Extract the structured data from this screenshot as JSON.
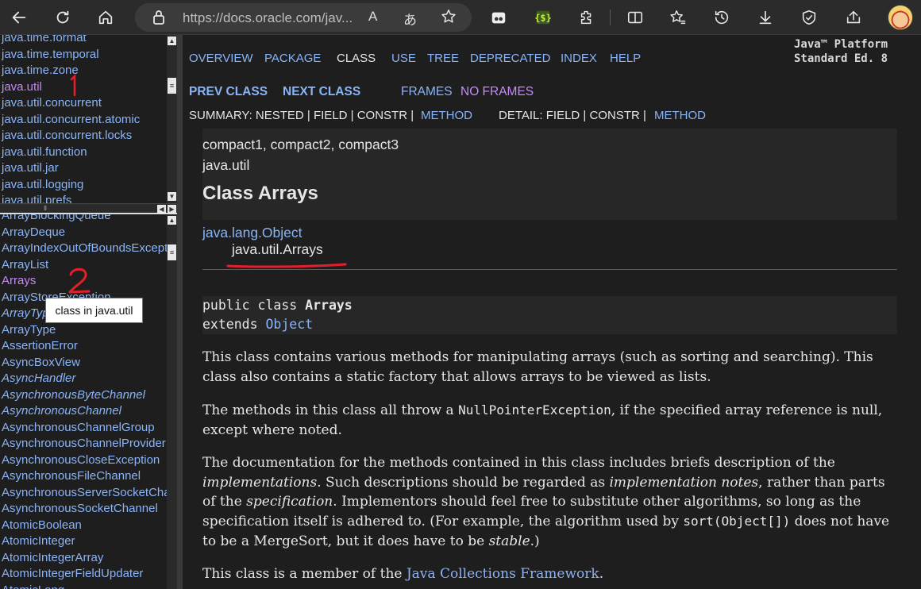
{
  "browser": {
    "url": "https://docs.oracle.com/jav...",
    "read_aloud": "A",
    "translate": "あ"
  },
  "packages_frame": {
    "items": [
      {
        "label": "java.time.format",
        "visited": false
      },
      {
        "label": "java.time.temporal",
        "visited": false
      },
      {
        "label": "java.time.zone",
        "visited": false
      },
      {
        "label": "java.util",
        "visited": true
      },
      {
        "label": "java.util.concurrent",
        "visited": false
      },
      {
        "label": "java.util.concurrent.atomic",
        "visited": false
      },
      {
        "label": "java.util.concurrent.locks",
        "visited": false
      },
      {
        "label": "java.util.function",
        "visited": false
      },
      {
        "label": "java.util.jar",
        "visited": false
      },
      {
        "label": "java.util.logging",
        "visited": false
      },
      {
        "label": "java.util.prefs",
        "visited": false
      }
    ]
  },
  "classes_frame": {
    "items": [
      {
        "label": "ArrayBlockingQueue",
        "italic": false,
        "visited": false
      },
      {
        "label": "ArrayDeque",
        "italic": false,
        "visited": false
      },
      {
        "label": "ArrayIndexOutOfBoundsException",
        "italic": false,
        "visited": false
      },
      {
        "label": "ArrayList",
        "italic": false,
        "visited": false
      },
      {
        "label": "Arrays",
        "italic": false,
        "visited": true
      },
      {
        "label": "ArrayStoreException",
        "italic": false,
        "visited": false
      },
      {
        "label": "ArrayType",
        "italic": true,
        "visited": false
      },
      {
        "label": "ArrayType",
        "italic": false,
        "visited": false
      },
      {
        "label": "AssertionError",
        "italic": false,
        "visited": false
      },
      {
        "label": "AsyncBoxView",
        "italic": false,
        "visited": false
      },
      {
        "label": "AsyncHandler",
        "italic": true,
        "visited": false
      },
      {
        "label": "AsynchronousByteChannel",
        "italic": true,
        "visited": false
      },
      {
        "label": "AsynchronousChannel",
        "italic": true,
        "visited": false
      },
      {
        "label": "AsynchronousChannelGroup",
        "italic": false,
        "visited": false
      },
      {
        "label": "AsynchronousChannelProvider",
        "italic": false,
        "visited": false
      },
      {
        "label": "AsynchronousCloseException",
        "italic": false,
        "visited": false
      },
      {
        "label": "AsynchronousFileChannel",
        "italic": false,
        "visited": false
      },
      {
        "label": "AsynchronousServerSocketChannel",
        "italic": false,
        "visited": false
      },
      {
        "label": "AsynchronousSocketChannel",
        "italic": false,
        "visited": false
      },
      {
        "label": "AtomicBoolean",
        "italic": false,
        "visited": false
      },
      {
        "label": "AtomicInteger",
        "italic": false,
        "visited": false
      },
      {
        "label": "AtomicIntegerArray",
        "italic": false,
        "visited": false
      },
      {
        "label": "AtomicIntegerFieldUpdater",
        "italic": false,
        "visited": false
      },
      {
        "label": "AtomicLong",
        "italic": false,
        "visited": false
      }
    ],
    "tooltip": "class in java.util"
  },
  "annotations": {
    "mark1": "1",
    "mark2": "2",
    "color": "#e0202a"
  },
  "main": {
    "nav": {
      "overview": "OVERVIEW",
      "package": "PACKAGE",
      "class": "CLASS",
      "use": "USE",
      "tree": "TREE",
      "deprecated": "DEPRECATED",
      "index": "INDEX",
      "help": "HELP"
    },
    "platform_line1": "Java™ Platform",
    "platform_line2": "Standard Ed. 8",
    "prev_class": "PREV CLASS",
    "next_class": "NEXT CLASS",
    "frames": "FRAMES",
    "no_frames": "NO FRAMES",
    "summary_label": "SUMMARY: NESTED | FIELD | CONSTR |",
    "summary_method": "METHOD",
    "detail_label": "DETAIL: FIELD | CONSTR |",
    "detail_method": "METHOD",
    "profiles": "compact1, compact2, compact3",
    "package_name": "java.util",
    "class_title": "Class Arrays",
    "inheritance_parent": "java.lang.Object",
    "inheritance_child": "java.util.Arrays",
    "signature": {
      "line1_prefix": "public class ",
      "line1_name": "Arrays",
      "line2_prefix": "extends ",
      "line2_link": "Object"
    },
    "para1": "This class contains various methods for manipulating arrays (such as sorting and searching). This class also contains a static factory that allows arrays to be viewed as lists.",
    "para2": {
      "before": "The methods in this class all throw a ",
      "code": "NullPointerException",
      "after": ", if the specified array reference is null, except where noted."
    },
    "para3": {
      "t1": "The documentation for the methods contained in this class includes briefs description of the ",
      "i1": "implementations",
      "t2": ". Such descriptions should be regarded as ",
      "i2": "implementation notes",
      "t3": ", rather than parts of the ",
      "i3": "specification",
      "t4": ". Implementors should feel free to substitute other algorithms, so long as the specification itself is adhered to. (For example, the algorithm used by ",
      "code": "sort(Object[])",
      "t5": " does not have to be a MergeSort, but it does have to be ",
      "i4": "stable",
      "t6": ".)"
    },
    "para4": {
      "before": "This class is a member of the ",
      "link": "Java Collections Framework",
      "after": "."
    }
  }
}
